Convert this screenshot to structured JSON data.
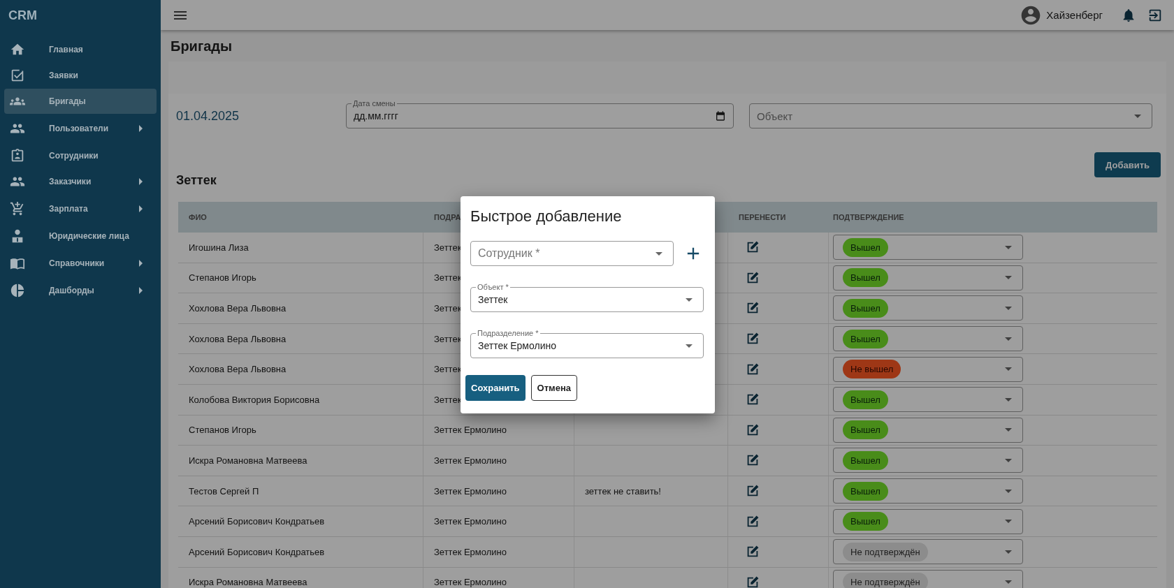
{
  "sidebar": {
    "logo": "CRM",
    "items": [
      {
        "label": "Главная",
        "selected": false,
        "submenu": false
      },
      {
        "label": "Заявки",
        "selected": false,
        "submenu": false
      },
      {
        "label": "Бригады",
        "selected": true,
        "submenu": false
      },
      {
        "label": "Пользователи",
        "selected": false,
        "submenu": true
      },
      {
        "label": "Сотрудники",
        "selected": false,
        "submenu": false
      },
      {
        "label": "Заказчики",
        "selected": false,
        "submenu": true
      },
      {
        "label": "Зарплата",
        "selected": false,
        "submenu": true
      },
      {
        "label": "Юридические лица",
        "selected": false,
        "submenu": false
      },
      {
        "label": "Справочники",
        "selected": false,
        "submenu": true
      },
      {
        "label": "Дашборды",
        "selected": false,
        "submenu": true
      }
    ]
  },
  "header": {
    "user": "Хайзенберг"
  },
  "page_title": "Бригады",
  "filters": {
    "date": "01.04.2025",
    "shift_date": {
      "label": "Дата смены",
      "value": "дд.мм.гггг"
    },
    "object": {
      "placeholder": "Объект"
    }
  },
  "add_button": "Добавить",
  "group_title": "Зеттек",
  "table": {
    "columns": [
      "ФИО",
      "ПОДРА",
      "ПЕРЕНЕСТИ",
      "ПОДТВЕРЖДЕНИЕ"
    ],
    "rows": [
      {
        "name": "Игошина Лиза",
        "unit": "Зеттек",
        "status": {
          "label": "Вышел",
          "kind": "went"
        }
      },
      {
        "name": "Степанов Игорь",
        "unit": "Зеттек",
        "status": {
          "label": "Вышел",
          "kind": "went"
        }
      },
      {
        "name": "Хохлова Вера Львовна",
        "unit": "Зеттек",
        "status": {
          "label": "Вышел",
          "kind": "went"
        }
      },
      {
        "name": "Хохлова Вера Львовна",
        "unit": "Зеттек",
        "status": {
          "label": "Вышел",
          "kind": "went"
        }
      },
      {
        "name": "Хохлова Вера Львовна",
        "unit": "Зеттек",
        "status": {
          "label": "Не вышел",
          "kind": "missed"
        }
      },
      {
        "name": "Колобова Виктория Борисовна",
        "unit": "Зеттек",
        "status": {
          "label": "Вышел",
          "kind": "went"
        }
      },
      {
        "name": "Степанов Игорь",
        "unit": "Зеттек Ермолино",
        "status": {
          "label": "Вышел",
          "kind": "went"
        }
      },
      {
        "name": "Искра Романовна Матвеева",
        "unit": "Зеттек Ермолино",
        "status": {
          "label": "Вышел",
          "kind": "went"
        }
      },
      {
        "name": "Тестов Сергей П",
        "unit": "Зеттек Ермолино",
        "note": "зеттек не ставить!",
        "status": {
          "label": "Вышел",
          "kind": "went"
        }
      },
      {
        "name": "Арсений Борисович Кондратьев",
        "unit": "Зеттек Ермолино",
        "status": {
          "label": "Вышел",
          "kind": "went"
        }
      },
      {
        "name": "Арсений Борисович Кондратьев",
        "unit": "Зеттек Ермолино",
        "status": {
          "label": "Не подтверждён",
          "kind": "pending"
        }
      },
      {
        "name": "Искра Романовна Матвеева",
        "unit": "Зеттек Ермолино",
        "status": {
          "label": "Не подтверждён",
          "kind": "pending"
        }
      }
    ]
  },
  "dialog": {
    "title": "Быстрое добавление",
    "employee": {
      "placeholder": "Сотрудник *"
    },
    "object": {
      "label": "Объект *",
      "value": "Зеттек"
    },
    "division": {
      "label": "Подразделение *",
      "value": "Зеттек Ермолино"
    },
    "buttons": [
      "Сохранить",
      "Отмена"
    ]
  }
}
